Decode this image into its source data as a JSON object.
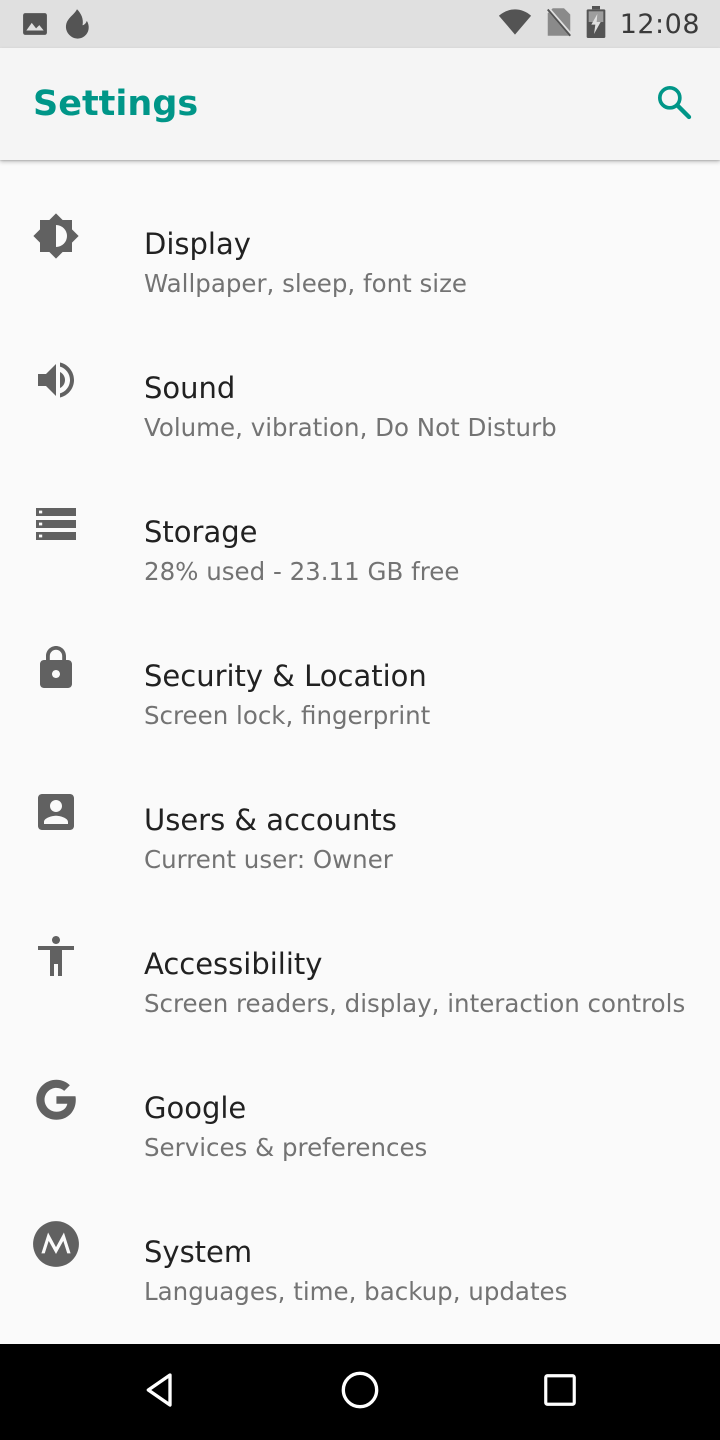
{
  "status_bar": {
    "time": "12:08",
    "left_icons": [
      "image-notification-icon",
      "fire-notification-icon"
    ],
    "right_icons": [
      "wifi-icon",
      "no-sim-icon",
      "battery-charging-icon"
    ]
  },
  "app_bar": {
    "title": "Settings",
    "search_icon": "search-icon",
    "accent_color": "#009688"
  },
  "settings": {
    "items": [
      {
        "id": "display",
        "icon": "brightness-icon",
        "title": "Display",
        "summary": "Wallpaper, sleep, font size"
      },
      {
        "id": "sound",
        "icon": "volume-icon",
        "title": "Sound",
        "summary": "Volume, vibration, Do Not Disturb"
      },
      {
        "id": "storage",
        "icon": "storage-icon",
        "title": "Storage",
        "summary": "28% used - 23.11 GB free"
      },
      {
        "id": "security",
        "icon": "lock-icon",
        "title": "Security & Location",
        "summary": "Screen lock, fingerprint"
      },
      {
        "id": "users",
        "icon": "account-box-icon",
        "title": "Users & accounts",
        "summary": "Current user: Owner"
      },
      {
        "id": "accessibility",
        "icon": "accessibility-icon",
        "title": "Accessibility",
        "summary": "Screen readers, display, interaction controls"
      },
      {
        "id": "google",
        "icon": "google-icon",
        "title": "Google",
        "summary": "Services & preferences"
      },
      {
        "id": "system",
        "icon": "motorola-icon",
        "title": "System",
        "summary": "Languages, time, backup, updates"
      }
    ]
  },
  "nav_bar": {
    "buttons": [
      "back-icon",
      "home-icon",
      "recents-icon"
    ]
  }
}
